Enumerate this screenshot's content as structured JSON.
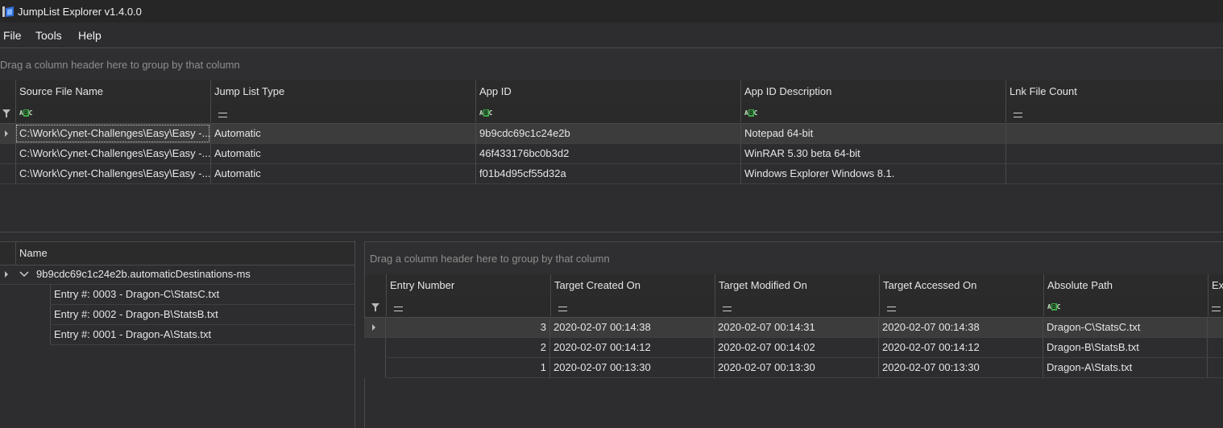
{
  "window": {
    "title": "JumpList Explorer v1.4.0.0"
  },
  "menu": [
    {
      "label": "File"
    },
    {
      "label": "Tools"
    },
    {
      "label": "Help"
    }
  ],
  "top_grid": {
    "group_hint": "Drag a column header here to group by that column",
    "columns": [
      "Source File Name",
      "Jump List Type",
      "App ID",
      "App ID Description",
      "Lnk File Count"
    ],
    "filters": [
      "abc",
      "eq",
      "abc",
      "abc",
      "eq"
    ],
    "rows": [
      {
        "source": "C:\\Work\\Cynet-Challenges\\Easy\\Easy -...",
        "type": "Automatic",
        "app_id": "9b9cdc69c1c24e2b",
        "desc": "Notepad 64-bit",
        "count": ""
      },
      {
        "source": "C:\\Work\\Cynet-Challenges\\Easy\\Easy -...",
        "type": "Automatic",
        "app_id": "46f433176bc0b3d2",
        "desc": "WinRAR 5.30 beta 64-bit",
        "count": ""
      },
      {
        "source": "C:\\Work\\Cynet-Challenges\\Easy\\Easy -...",
        "type": "Automatic",
        "app_id": "f01b4d95cf55d32a",
        "desc": "Windows Explorer Windows 8.1.",
        "count": ""
      }
    ]
  },
  "tree": {
    "header": "Name",
    "root": "9b9cdc69c1c24e2b.automaticDestinations-ms",
    "children": [
      "Entry #: 0003 - Dragon-C\\StatsC.txt",
      "Entry #: 0002 - Dragon-B\\StatsB.txt",
      "Entry #: 0001 - Dragon-A\\Stats.txt"
    ]
  },
  "entry_grid": {
    "group_hint": "Drag a column header here to group by that column",
    "columns": [
      "Entry Number",
      "Target Created On",
      "Target Modified On",
      "Target Accessed On",
      "Absolute Path",
      "Ext"
    ],
    "rows": [
      {
        "num": "3",
        "created": "2020-02-07 00:14:38",
        "modified": "2020-02-07 00:14:31",
        "accessed": "2020-02-07 00:14:38",
        "path": "Dragon-C\\StatsC.txt"
      },
      {
        "num": "2",
        "created": "2020-02-07 00:14:12",
        "modified": "2020-02-07 00:14:02",
        "accessed": "2020-02-07 00:14:12",
        "path": "Dragon-B\\StatsB.txt"
      },
      {
        "num": "1",
        "created": "2020-02-07 00:13:30",
        "modified": "2020-02-07 00:13:30",
        "accessed": "2020-02-07 00:13:30",
        "path": "Dragon-A\\Stats.txt"
      }
    ]
  }
}
